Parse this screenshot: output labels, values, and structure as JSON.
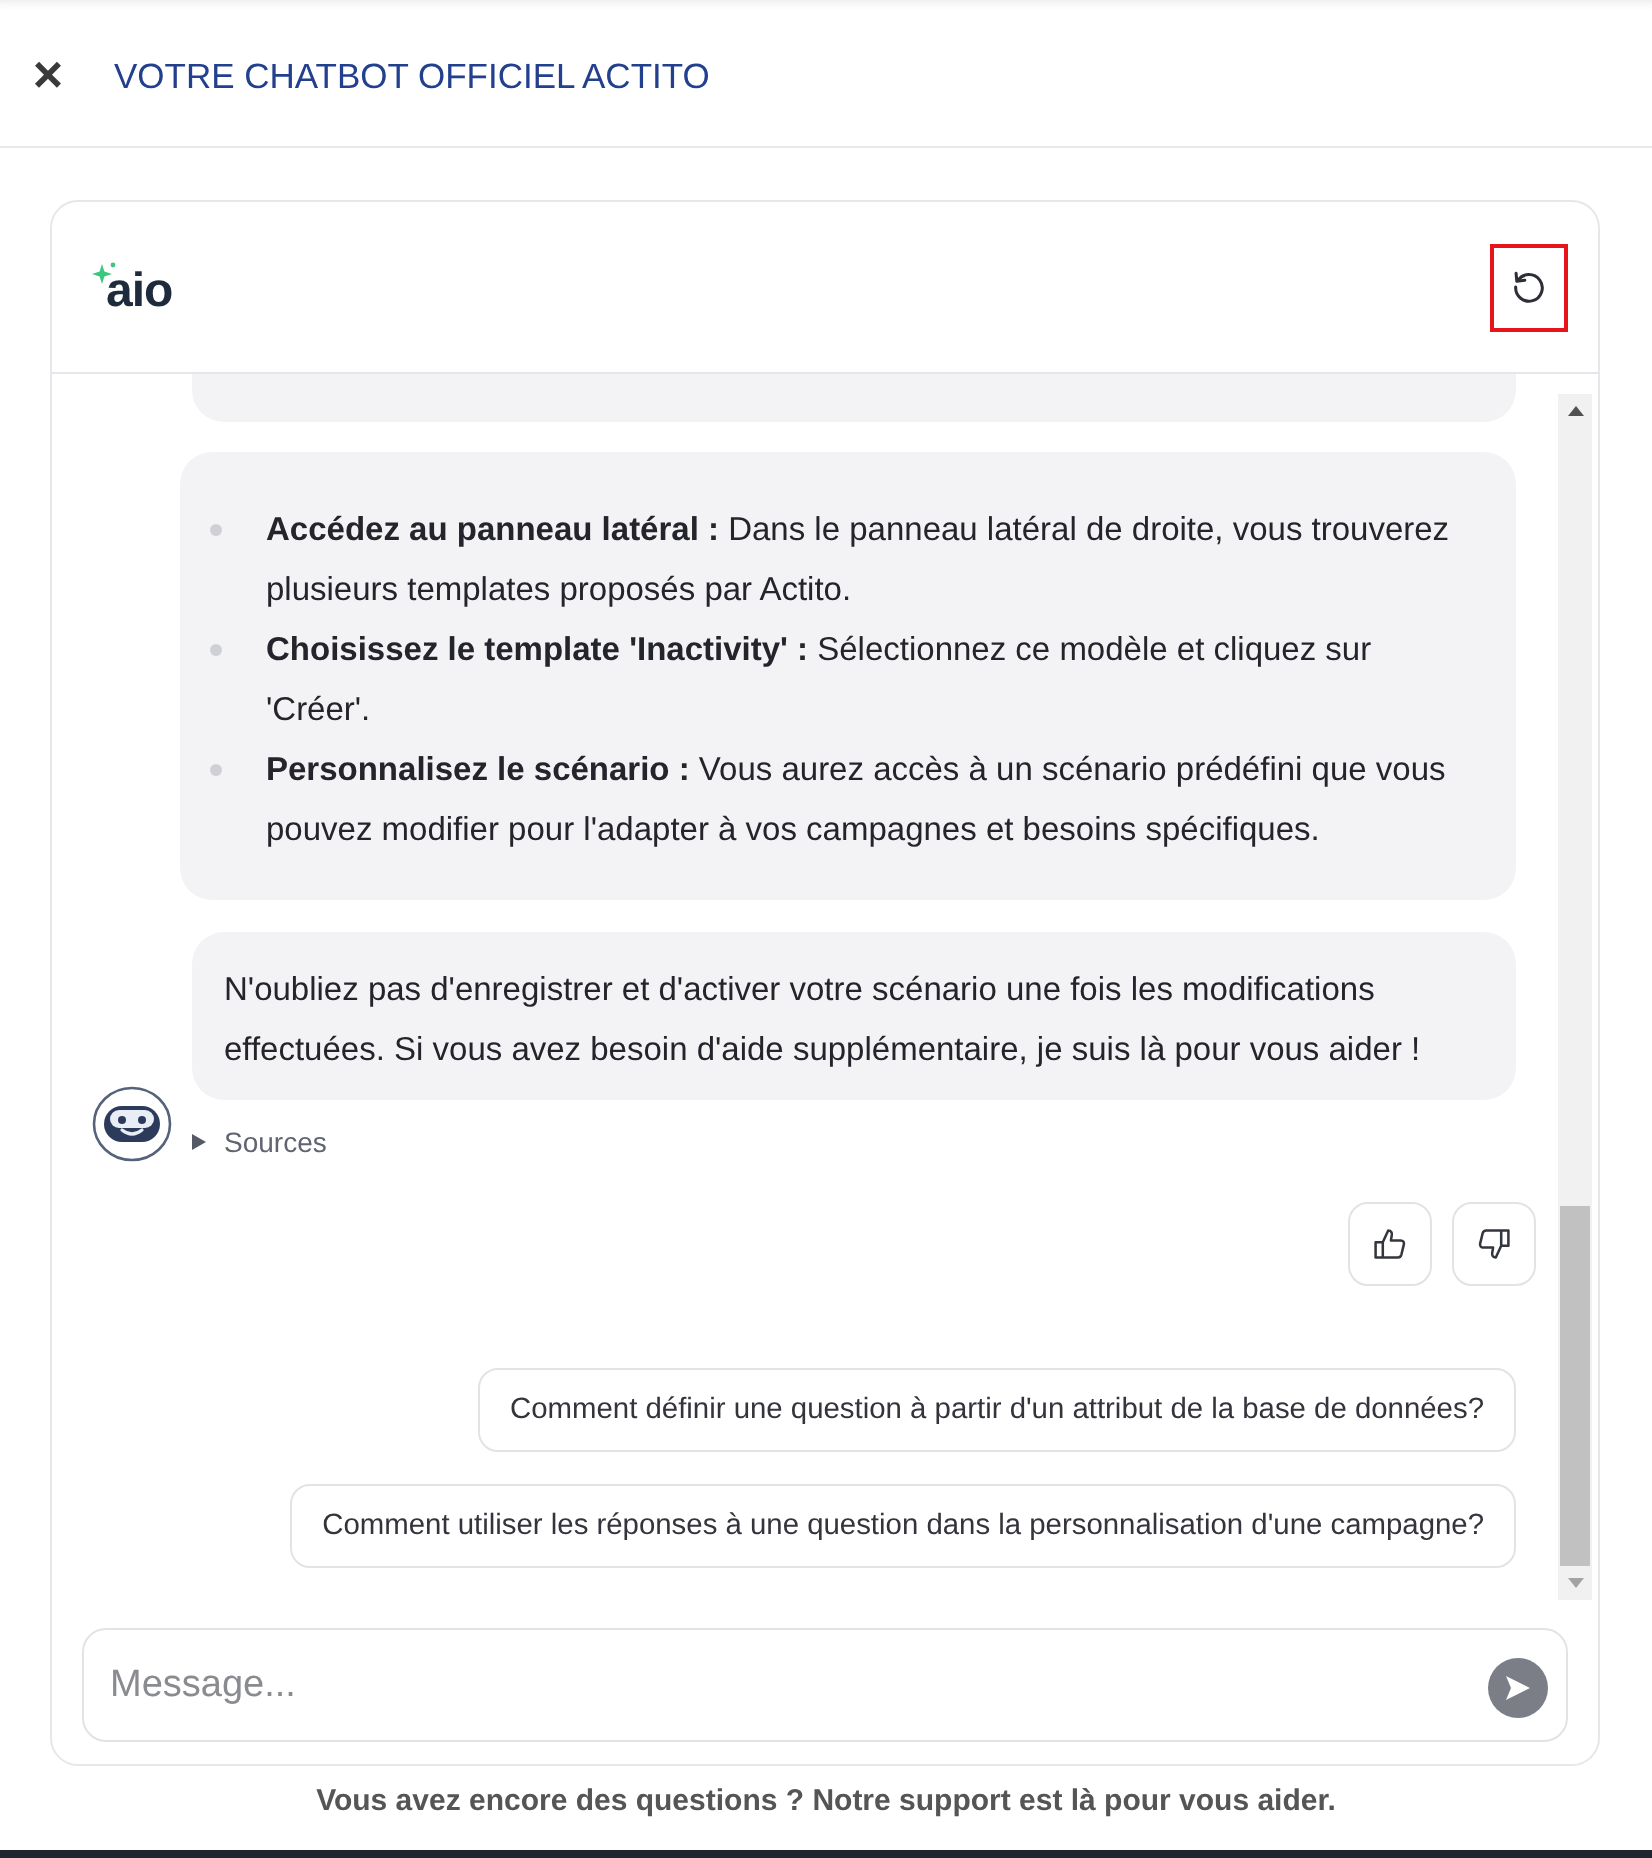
{
  "header": {
    "close_label": "×",
    "title": "VOTRE CHATBOT OFFICIEL ACTITO"
  },
  "chat": {
    "logo_text": "aio",
    "messages": [
      {
        "kind": "clipped"
      },
      {
        "kind": "list",
        "items": [
          "**Accédez au panneau latéral :** Dans le panneau latéral de droite, vous trouverez plusieurs templates proposés par Actito.",
          "**Choisissez le template 'Inactivity' :** Sélectionnez ce modèle et cliquez sur 'Créer'.",
          "**Personnalisez le scénario :** Vous aurez accès à un scénario prédéfini que vous pouvez modifier pour l'adapter à vos campagnes et besoins spécifiques."
        ]
      },
      {
        "kind": "text",
        "text": "N'oubliez pas d'enregistrer et d'activer votre scénario une fois les modifications effectuées. Si vous avez besoin d'aide supplémentaire, je suis là pour vous aider !"
      }
    ],
    "sources": {
      "label": "Sources",
      "expanded": false
    },
    "suggestions": [
      "Comment définir une question à partir d'un attribut de la base de données?",
      "Comment utiliser les réponses à une question dans la personnalisation d'une campagne?"
    ]
  },
  "composer": {
    "placeholder": "Message..."
  },
  "footer": "Vous avez encore des questions ? Notre support est là pour vous aider."
}
